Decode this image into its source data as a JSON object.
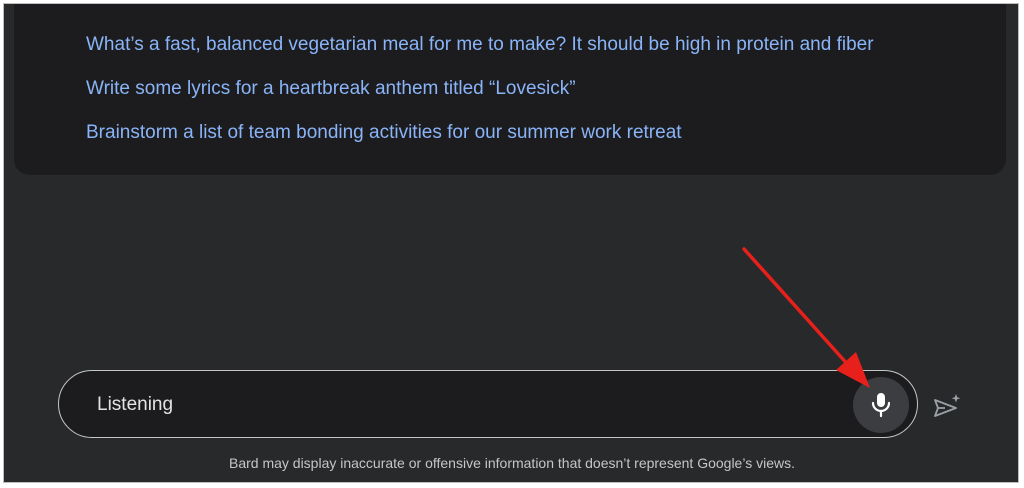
{
  "suggestions": [
    {
      "text": "What’s a fast, balanced vegetarian meal for me to make? It should be high in protein and fiber"
    },
    {
      "text": "Write some lyrics for a heartbreak anthem titled “Lovesick”"
    },
    {
      "text": "Brainstorm a list of team bonding activities for our summer work retreat"
    }
  ],
  "input": {
    "text": "Listening",
    "mic_icon": "microphone-icon",
    "send_icon": "send-sparkle-icon"
  },
  "disclaimer": "Bard may display inaccurate or offensive information that doesn’t represent Google’s views.",
  "colors": {
    "background": "#28292b",
    "card": "#1c1c1e",
    "suggestion_text": "#8ab4f8",
    "annotation_arrow": "#e8201c"
  }
}
